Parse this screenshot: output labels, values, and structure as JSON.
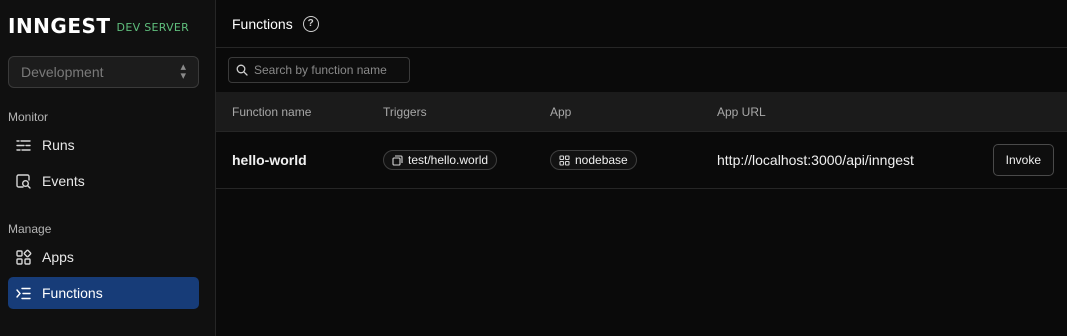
{
  "brand": {
    "logo": "INNGEST",
    "tag": "DEV SERVER"
  },
  "environment": {
    "selected": "Development"
  },
  "sidebar": {
    "monitor_label": "Monitor",
    "manage_label": "Manage",
    "items": [
      {
        "label": "Runs",
        "icon": "runs-list-icon",
        "active": false
      },
      {
        "label": "Events",
        "icon": "events-search-icon",
        "active": false
      },
      {
        "label": "Apps",
        "icon": "apps-grid-icon",
        "active": false
      },
      {
        "label": "Functions",
        "icon": "functions-list-icon",
        "active": true
      }
    ]
  },
  "header": {
    "title": "Functions",
    "help_icon": "help-circle-icon"
  },
  "search": {
    "placeholder": "Search by function name",
    "value": ""
  },
  "table": {
    "columns": [
      "Function name",
      "Triggers",
      "App",
      "App URL",
      ""
    ],
    "rows": [
      {
        "function_name": "hello-world",
        "trigger": "test/hello.world",
        "app": "nodebase",
        "app_url": "http://localhost:3000/api/inngest",
        "action": "Invoke"
      }
    ]
  },
  "colors": {
    "active_nav": "#173c78",
    "brand_tag": "#5fbf7d",
    "background": "#0a0a0a"
  }
}
